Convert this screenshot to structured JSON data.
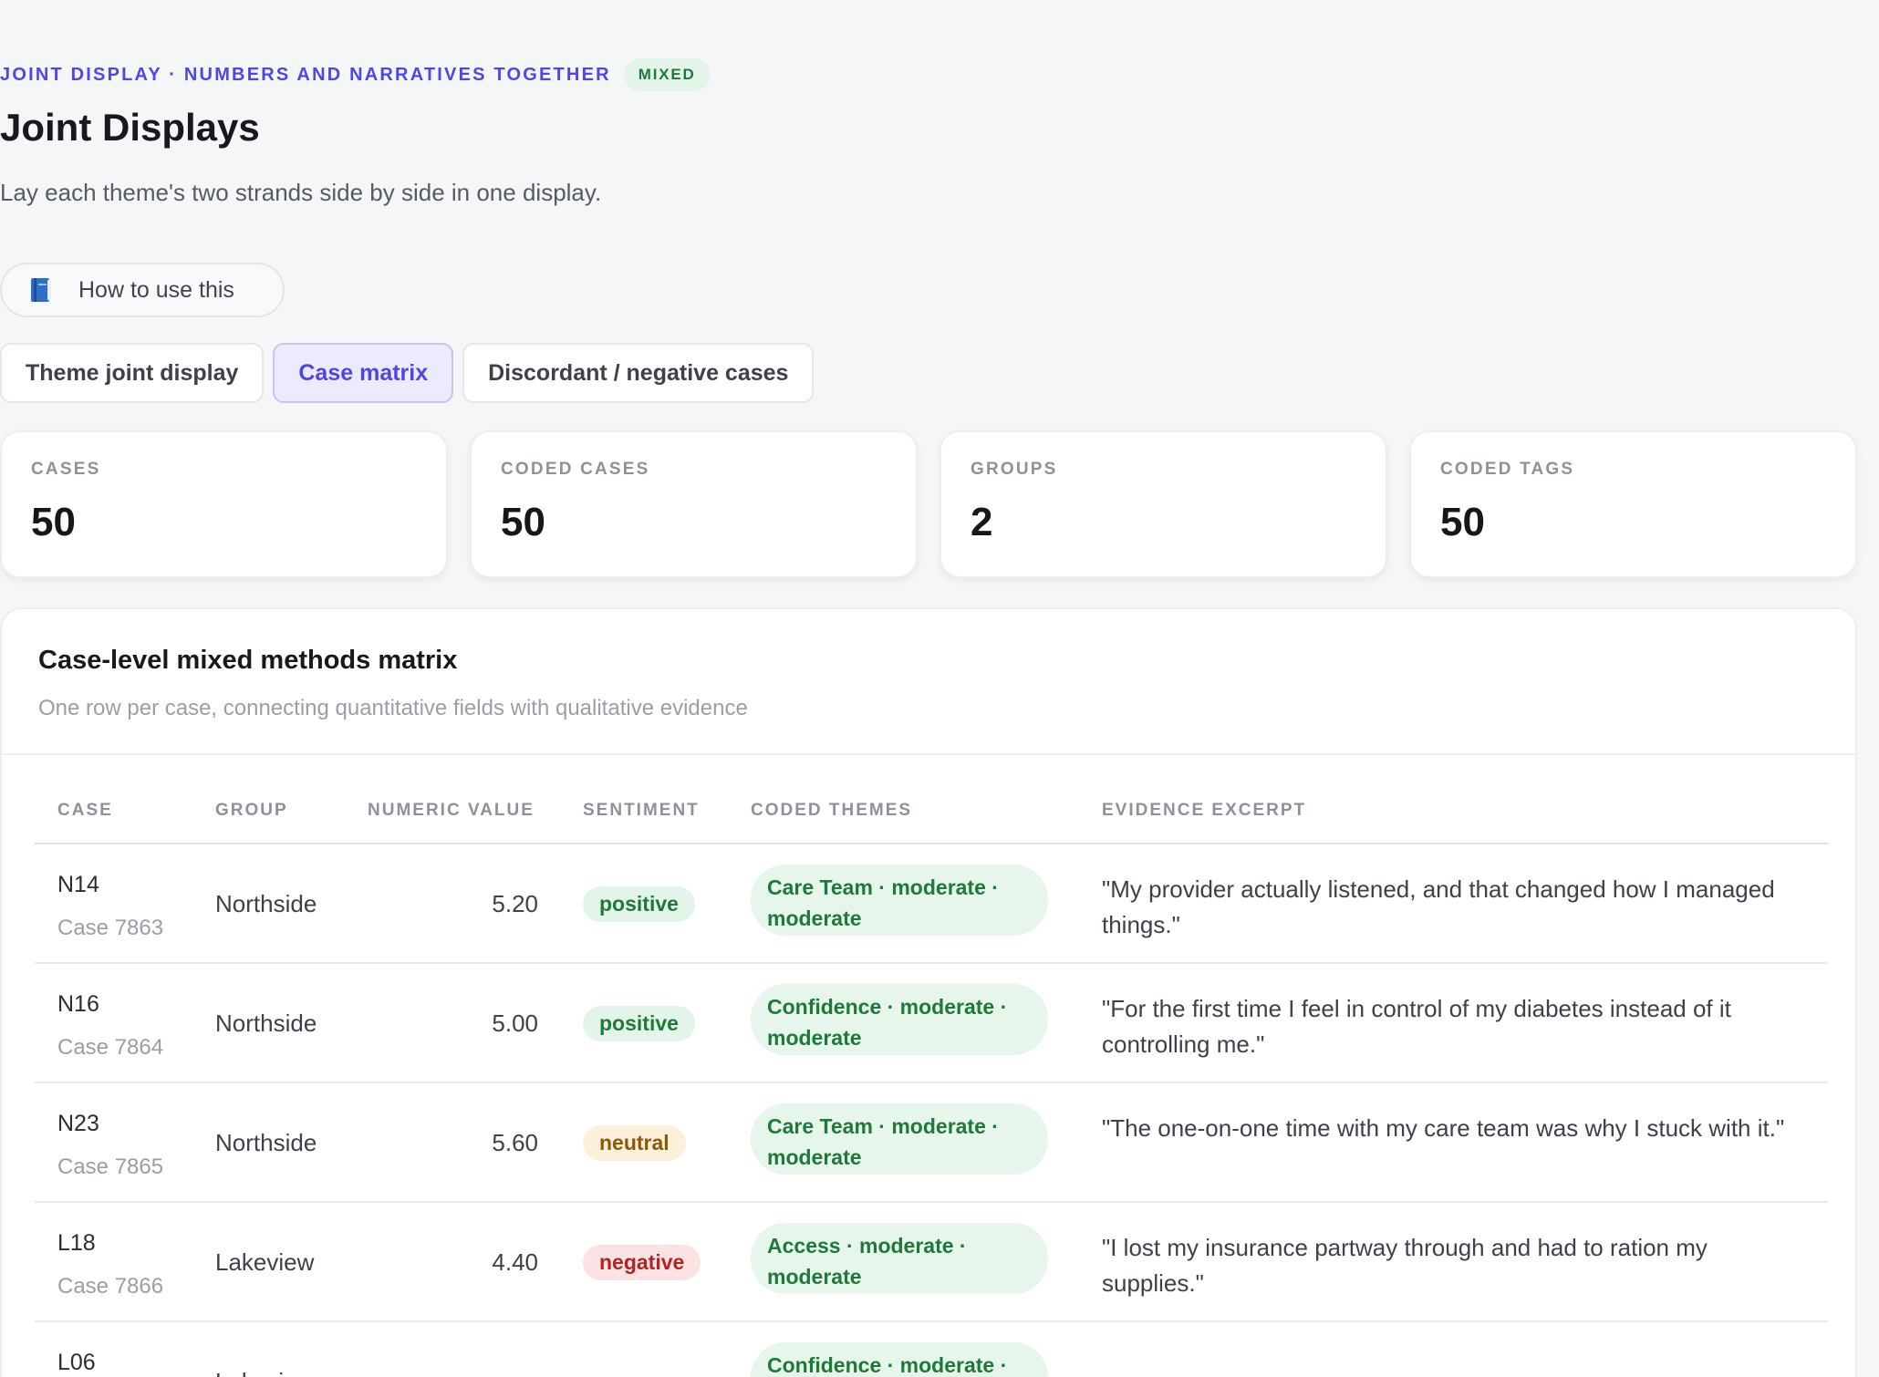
{
  "header": {
    "eyebrow": "JOINT DISPLAY · NUMBERS AND NARRATIVES TOGETHER",
    "badge": "MIXED",
    "title": "Joint Displays",
    "subtitle": "Lay each theme's two strands side by side in one display."
  },
  "howto": {
    "icon": "book-icon",
    "label": "How to use this"
  },
  "tabs": [
    {
      "label": "Theme joint display",
      "active": false
    },
    {
      "label": "Case matrix",
      "active": true
    },
    {
      "label": "Discordant / negative cases",
      "active": false
    }
  ],
  "stats": [
    {
      "label": "CASES",
      "value": "50"
    },
    {
      "label": "CODED CASES",
      "value": "50"
    },
    {
      "label": "GROUPS",
      "value": "2"
    },
    {
      "label": "CODED TAGS",
      "value": "50"
    }
  ],
  "matrix": {
    "title": "Case-level mixed methods matrix",
    "subtitle": "One row per case, connecting quantitative fields with qualitative evidence",
    "columns": {
      "case": "CASE",
      "group": "GROUP",
      "numeric": "NUMERIC VALUE",
      "sentiment": "SENTIMENT",
      "themes": "CODED THEMES",
      "excerpt": "EVIDENCE EXCERPT"
    },
    "rows": [
      {
        "id": "N14",
        "case": "Case 7863",
        "group": "Northside",
        "value": "5.20",
        "sentiment": "positive",
        "themes": "Care Team · moderate · moderate",
        "excerpt": "\"My provider actually listened, and that changed how I managed things.\""
      },
      {
        "id": "N16",
        "case": "Case 7864",
        "group": "Northside",
        "value": "5.00",
        "sentiment": "positive",
        "themes": "Confidence · moderate · moderate",
        "excerpt": "\"For the first time I feel in control of my diabetes instead of it controlling me.\""
      },
      {
        "id": "N23",
        "case": "Case 7865",
        "group": "Northside",
        "value": "5.60",
        "sentiment": "neutral",
        "themes": "Care Team · moderate · moderate",
        "excerpt": "\"The one-on-one time with my care team was why I stuck with it.\""
      },
      {
        "id": "L18",
        "case": "Case 7866",
        "group": "Lakeview",
        "value": "4.40",
        "sentiment": "negative",
        "themes": "Access · moderate · moderate",
        "excerpt": "\"I lost my insurance partway through and had to ration my supplies.\""
      },
      {
        "id": "L06",
        "case": "",
        "group": "Lakeview",
        "value": "",
        "sentiment": "",
        "themes": "Confidence · moderate ·",
        "excerpt": ""
      }
    ]
  },
  "colors": {
    "accent": "#4f46e5",
    "positive": "#1f7a3a",
    "neutral": "#8a5a0c",
    "negative": "#b42323"
  }
}
